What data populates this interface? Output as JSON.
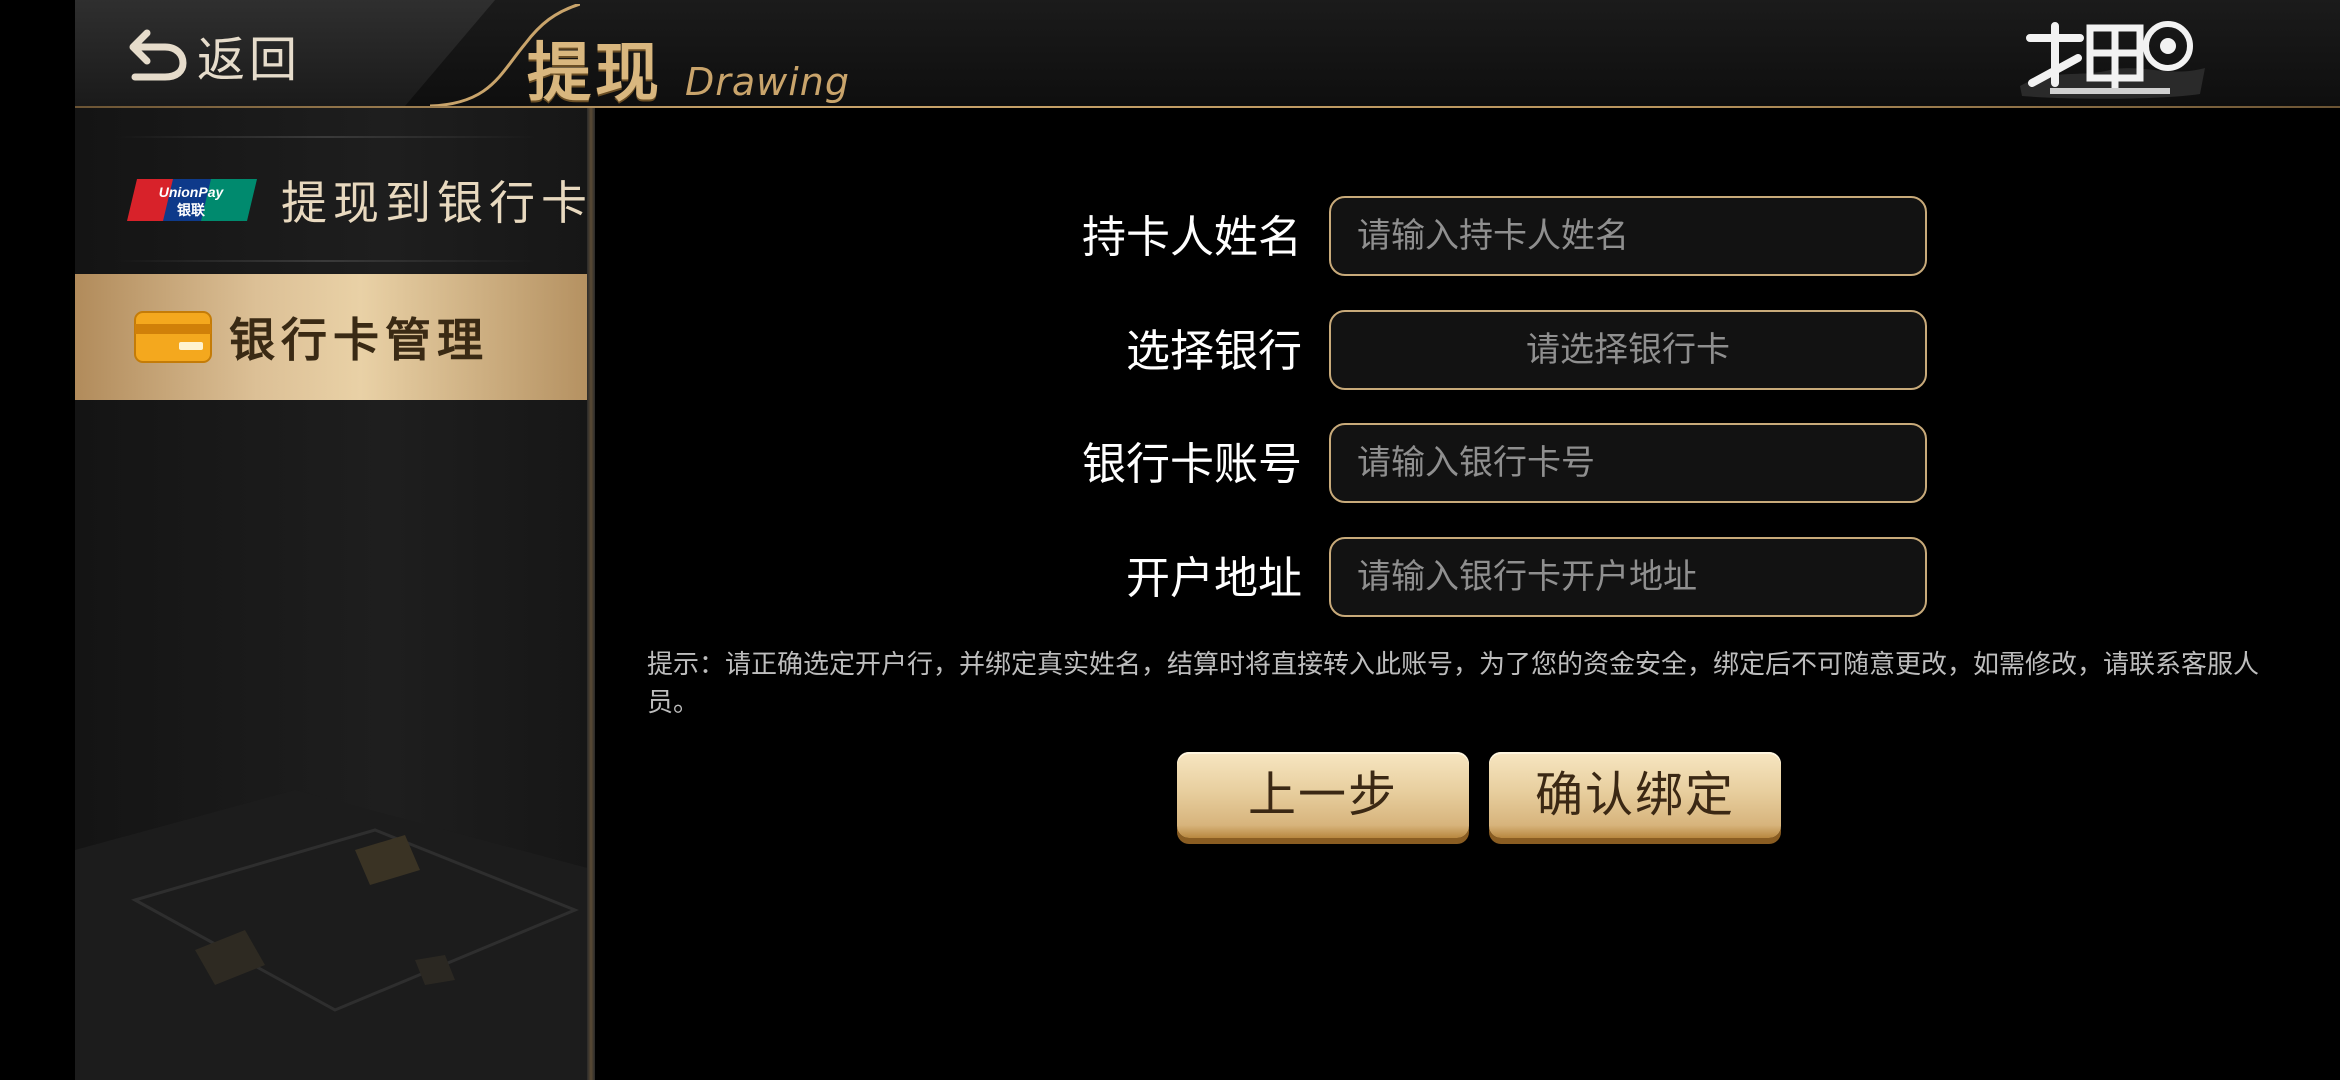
{
  "header": {
    "back_label": "返回",
    "title_cn": "提现",
    "title_en": "Drawing"
  },
  "sidebar": {
    "items": [
      {
        "label": "提现到银行卡",
        "icon": "unionpay-icon",
        "active": false
      },
      {
        "label": "银行卡管理",
        "icon": "bank-card-icon",
        "active": true
      }
    ]
  },
  "form": {
    "fields": [
      {
        "label": "持卡人姓名",
        "placeholder": "请输入持卡人姓名",
        "type": "text"
      },
      {
        "label": "选择银行",
        "value": "请选择银行卡",
        "type": "select"
      },
      {
        "label": "银行卡账号",
        "placeholder": "请输入银行卡号",
        "type": "text"
      },
      {
        "label": "开户地址",
        "placeholder": "请输入银行卡开户地址",
        "type": "text"
      }
    ],
    "hint": "提示：请正确选定开户行，并绑定真实姓名，结算时将直接转入此账号，为了您的资金安全，绑定后不可随意更改，如需修改，请联系客服人员。",
    "buttons": {
      "prev": "上一步",
      "confirm": "确认绑定"
    }
  },
  "colors": {
    "accent_gold": "#c8aa7a",
    "active_tab": "#dcc096",
    "background": "#000000"
  }
}
